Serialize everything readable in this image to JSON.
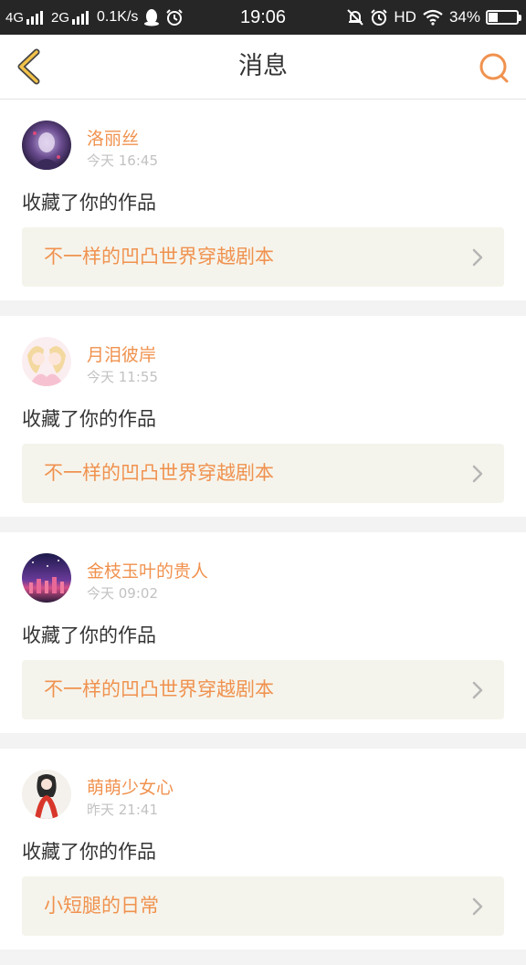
{
  "status_bar": {
    "network1": "4G",
    "network2": "2G",
    "speed": "0.1K/s",
    "time": "19:06",
    "hd": "HD",
    "battery_text": "34%",
    "battery_level": 0.34
  },
  "header": {
    "title": "消息"
  },
  "messages": [
    {
      "user": "洛丽丝",
      "time": "今天 16:45",
      "action": "收藏了你的作品",
      "work": "不一样的凹凸世界穿越剧本"
    },
    {
      "user": "月泪彼岸",
      "time": "今天 11:55",
      "action": "收藏了你的作品",
      "work": "不一样的凹凸世界穿越剧本"
    },
    {
      "user": "金枝玉叶的贵人",
      "time": "今天 09:02",
      "action": "收藏了你的作品",
      "work": "不一样的凹凸世界穿越剧本"
    },
    {
      "user": "萌萌少女心",
      "time": "昨天 21:41",
      "action": "收藏了你的作品",
      "work": "小短腿的日常"
    }
  ],
  "colors": {
    "accent": "#f0924f",
    "back_arrow": "#f2c24a",
    "work_bg": "#f5f4ec"
  }
}
